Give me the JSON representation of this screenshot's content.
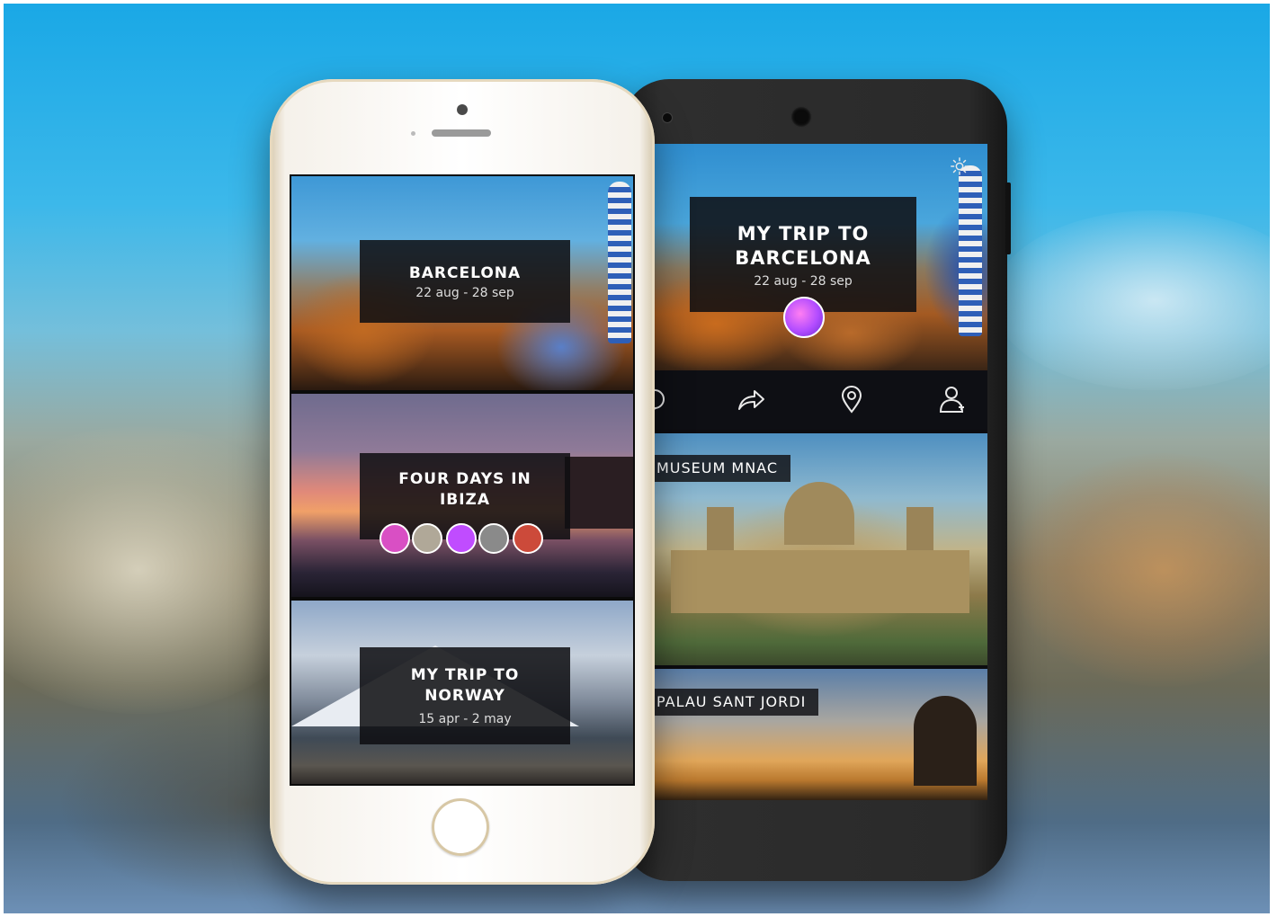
{
  "iphone": {
    "trips": [
      {
        "title": "BARCELONA",
        "dates": "22 aug - 28 sep"
      },
      {
        "title": "FOUR DAYS IN IBIZA",
        "dates": ""
      },
      {
        "title": "MY TRIP TO NORWAY",
        "dates": "15 apr - 2 may"
      }
    ],
    "ibiza_avatars": [
      {
        "icon": "avatar",
        "color": "#d94fc4"
      },
      {
        "icon": "avatar",
        "color": "#b0a898"
      },
      {
        "icon": "avatar",
        "color": "#c04cff"
      },
      {
        "icon": "avatar",
        "color": "#8a8a8a"
      },
      {
        "icon": "avatar",
        "color": "#cc4a3a"
      }
    ]
  },
  "android": {
    "header": {
      "title": "MY TRIP TO BARCELONA",
      "dates": "22 aug - 28 sep"
    },
    "toolbar": [
      "chat-icon",
      "share-icon",
      "location-pin-icon",
      "user-icon"
    ],
    "places": [
      {
        "label": "MUSEUM MNAC"
      },
      {
        "label": "PALAU SANT JORDI"
      }
    ]
  },
  "colors": {
    "label_bg": "#0e0e12",
    "toolbar_bg": "#0e0f14",
    "avatar_accent": "#b24cff"
  }
}
